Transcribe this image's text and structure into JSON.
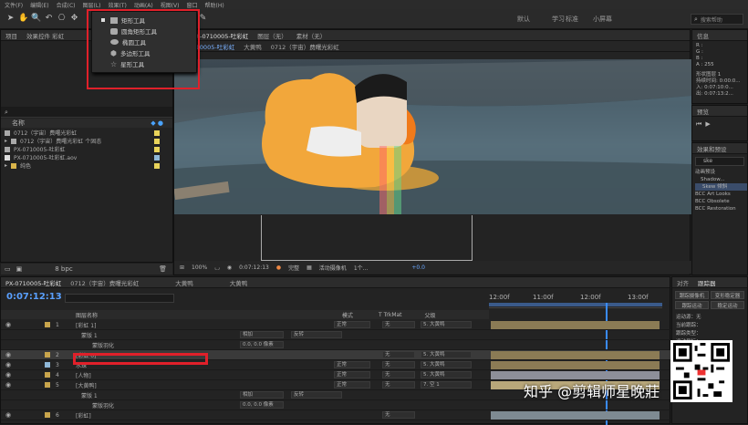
{
  "menu": [
    "文件(F)",
    "编辑(E)",
    "合成(C)",
    "图层(L)",
    "效果(T)",
    "动画(A)",
    "视图(V)",
    "窗口",
    "帮助(H)"
  ],
  "toolbar": {
    "ws1": "默认",
    "ws2": "学习",
    "ws3": "标准",
    "ws4": "小屏幕",
    "search_placeholder": "搜索帮助"
  },
  "shape_menu": {
    "items": [
      "矩形工具",
      "圆角矩形工具",
      "椭圆工具",
      "多边形工具",
      "星形工具"
    ]
  },
  "project": {
    "tab": "项目",
    "tab2": "效果控件 彩虹",
    "col_name": "名称",
    "items": [
      "0712（宇宙）费曙光彩虹",
      "0712（宇宙）费曙光彩虹 个固态",
      "PX-0710005-吐彩虹",
      "PX-0710005-吐彩虹.aov",
      "纯色"
    ],
    "bpc": "8 bpc"
  },
  "comp": {
    "tab": "合成",
    "tab_name": "PX-0710005-吐彩虹",
    "layer_tab": "图层（无）",
    "footage_tab": "素材（无）",
    "crumbs": [
      "PX-0710005-吐彩虹",
      "大黄鸭",
      "0712（宇宙）费曙光彩虹"
    ],
    "zoom": "100%",
    "timecode": "0:07:12:13",
    "quality": "完整",
    "camera": "活动摄像机",
    "views": "1个...",
    "exposure": "+0.0"
  },
  "info": {
    "tab": "信息",
    "r": "R :",
    "g": "G :",
    "b": "B :",
    "a": "A : 255",
    "x": "X : 1012",
    "y": "Y : 520",
    "layer": "形状图层 1",
    "dur": "持续时间: 0:00:0...",
    "in": "入: 0:07:10:0...",
    "out": "出: 0:07:13:2..."
  },
  "preview": {
    "tab": "预览"
  },
  "effects": {
    "tab": "效果和预设",
    "search": "ske",
    "items": [
      "动画预设",
      "Shadow...",
      "Skew 倾斜",
      "BCC Art Looks",
      "BCC Obsolete",
      "BCC Restoration"
    ]
  },
  "timeline": {
    "timecode": "0:07:12:13",
    "tabs": [
      "PX-0710005-吐彩虹",
      "0712（宇宙）费曙光彩虹",
      "大黄鸭",
      "大黄鸭"
    ],
    "col_layer": "图层名称",
    "col_mode": "模式",
    "col_trk": "T TrkMat",
    "col_parent": "父级",
    "ruler": [
      "12:00f",
      "11:00f",
      "12:00f",
      "13:00f"
    ],
    "rows": [
      {
        "num": "1",
        "name": "[彩虹 1]",
        "mode": "正常",
        "parent": "5. 大黄鸭"
      },
      {
        "num": "",
        "name": "蒙版 1",
        "mode": "相加",
        "parent": "反转"
      },
      {
        "num": "",
        "name": "蒙版羽化",
        "mode": "0.0, 0.0 像素",
        "parent": ""
      },
      {
        "num": "2",
        "name": "[彩虹 0]",
        "mode": "",
        "parent": "5. 大黄鸭"
      },
      {
        "num": "3",
        "name": "水珠",
        "mode": "正常",
        "parent": "5. 大黄鸭"
      },
      {
        "num": "4",
        "name": "[人物]",
        "mode": "正常",
        "parent": "5. 大黄鸭"
      },
      {
        "num": "5",
        "name": "[大黄鸭]",
        "mode": "正常",
        "parent": "7. 空 1"
      },
      {
        "num": "",
        "name": "蒙版 1",
        "mode": "相加",
        "parent": "反转"
      },
      {
        "num": "",
        "name": "蒙版羽化",
        "mode": "0.0, 0.0 像素",
        "parent": ""
      },
      {
        "num": "6",
        "name": "[彩虹]",
        "mode": "",
        "parent": ""
      }
    ],
    "trk_none": "无",
    "bar_colors": [
      "#8b7b55",
      "#8b7b55",
      "#8b7b55",
      "#8d8f99",
      "#b8a77a",
      "#7e8a92",
      "#8b7b55"
    ]
  },
  "right": {
    "tab1": "对齐",
    "tab2": "跟踪器",
    "btn1": "跟踪摄像机",
    "btn2": "变形稳定器",
    "btn3": "跟踪运动",
    "btn4": "稳定运动",
    "motion_src": "运动源：",
    "motion_src_val": "无",
    "current": "当前跟踪：",
    "track_type": "跟踪类型：",
    "motion_target": "运动目标：",
    "analyze": "分析：",
    "apply": "应用"
  },
  "watermark": "知乎 @剪辑师星晚莊",
  "qr_caption": "扫码学习"
}
